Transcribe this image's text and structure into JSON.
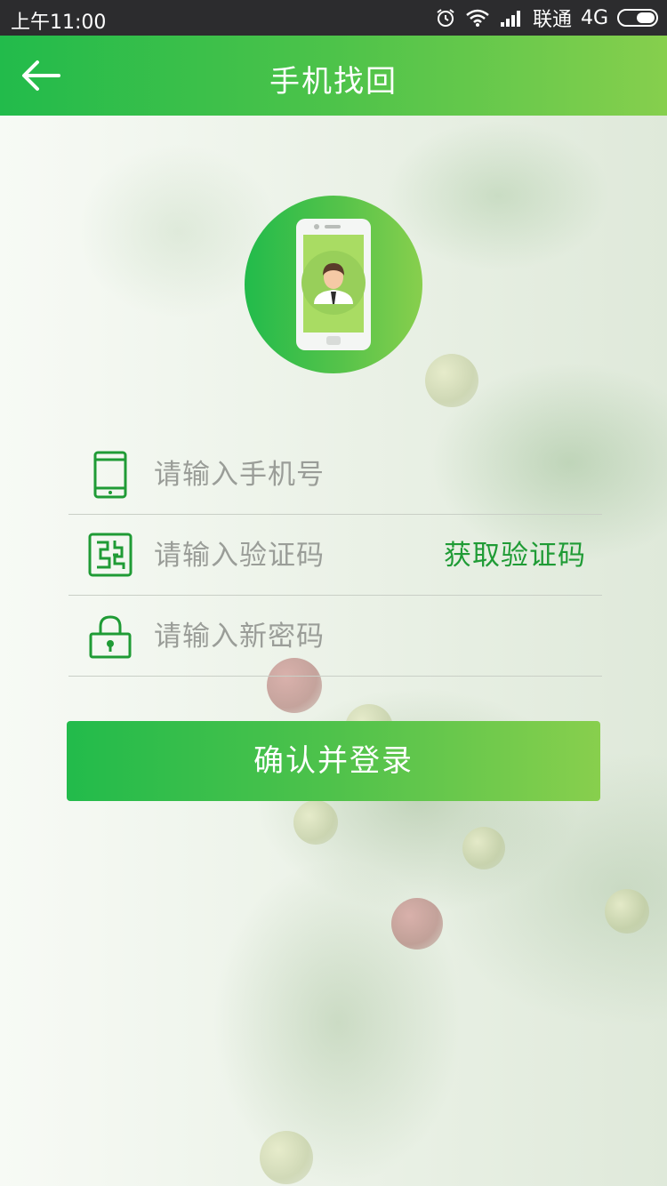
{
  "status_bar": {
    "time": "上午11:00",
    "carrier": "联通",
    "network": "4G",
    "icons": [
      "alarm-icon",
      "wifi-icon",
      "signal-icon",
      "battery-icon"
    ]
  },
  "header": {
    "title": "手机找回",
    "back_icon": "back-arrow-icon"
  },
  "avatar": {
    "icon": "phone-user-icon"
  },
  "form": {
    "phone": {
      "placeholder": "请输入手机号",
      "value": "",
      "icon": "mobile-phone-icon"
    },
    "code": {
      "placeholder": "请输入验证码",
      "value": "",
      "icon": "verification-code-icon",
      "action_label": "获取验证码"
    },
    "password": {
      "placeholder": "请输入新密码",
      "value": "",
      "icon": "lock-icon"
    }
  },
  "confirm_button": {
    "label": "确认并登录"
  },
  "colors": {
    "accent_green": "#22bb4b",
    "accent_green_light": "#88cf4d",
    "link_green": "#1f9b35",
    "placeholder_gray": "#9a9d98"
  }
}
